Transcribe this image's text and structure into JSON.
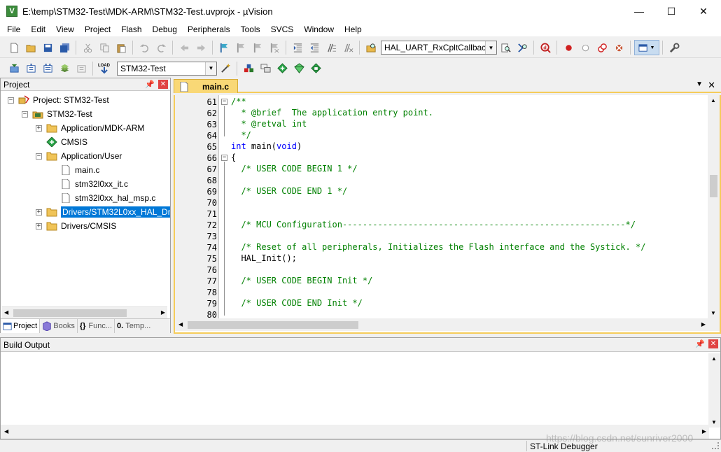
{
  "window": {
    "title": "E:\\temp\\STM32-Test\\MDK-ARM\\STM32-Test.uvprojx - µVision",
    "app_icon_label": "V",
    "minimize_glyph": "—",
    "maximize_glyph": "☐",
    "close_glyph": "✕"
  },
  "menu": [
    "File",
    "Edit",
    "View",
    "Project",
    "Flash",
    "Debug",
    "Peripherals",
    "Tools",
    "SVCS",
    "Window",
    "Help"
  ],
  "toolbar": {
    "function_combo_value": "HAL_UART_RxCpltCallbac",
    "target_combo_value": "STM32-Test",
    "load_label": "LOAD"
  },
  "project_panel": {
    "title": "Project",
    "pin_glyph": "📌",
    "close_glyph": "✕",
    "tree": [
      {
        "label": "Project: STM32-Test",
        "expander": "−",
        "icon": "project-icon"
      },
      {
        "label": "STM32-Test",
        "expander": "−",
        "icon": "target-icon"
      },
      {
        "label": "Application/MDK-ARM",
        "expander": "+",
        "icon": "folder-icon"
      },
      {
        "label": "CMSIS",
        "expander": "",
        "icon": "green-diamond-icon"
      },
      {
        "label": "Application/User",
        "expander": "−",
        "icon": "folder-icon"
      },
      {
        "label": "main.c",
        "expander": "",
        "icon": "file-icon"
      },
      {
        "label": "stm32l0xx_it.c",
        "expander": "",
        "icon": "file-icon"
      },
      {
        "label": "stm32l0xx_hal_msp.c",
        "expander": "",
        "icon": "file-icon"
      },
      {
        "label": "Drivers/STM32L0xx_HAL_Driv",
        "expander": "+",
        "icon": "folder-icon"
      },
      {
        "label": "Drivers/CMSIS",
        "expander": "+",
        "icon": "folder-icon"
      }
    ],
    "tabs": [
      {
        "label": "Project",
        "icon": "project-tab-icon"
      },
      {
        "label": "Books",
        "icon": "books-icon"
      },
      {
        "label": "Func...",
        "icon": "braces-icon"
      },
      {
        "label": "Temp...",
        "icon": "template-icon"
      }
    ],
    "tab_glyphs": {
      "braces": "{}",
      "template": "0."
    }
  },
  "editor": {
    "tab_label": "main.c",
    "tab_menu_glyph": "▼",
    "tab_close_glyph": "✕",
    "fold_minus": "−",
    "lines": [
      {
        "n": "61",
        "segs": [
          {
            "c": "cm",
            "t": "/**"
          }
        ]
      },
      {
        "n": "62",
        "segs": [
          {
            "c": "cm",
            "t": "  * @brief  The application entry point."
          }
        ]
      },
      {
        "n": "63",
        "segs": [
          {
            "c": "cm",
            "t": "  * @retval int"
          }
        ]
      },
      {
        "n": "64",
        "segs": [
          {
            "c": "cm",
            "t": "  */"
          }
        ]
      },
      {
        "n": "65",
        "segs": [
          {
            "c": "kw",
            "t": "int"
          },
          {
            "c": "tx",
            "t": " main("
          },
          {
            "c": "kw",
            "t": "void"
          },
          {
            "c": "tx",
            "t": ")"
          }
        ]
      },
      {
        "n": "66",
        "segs": [
          {
            "c": "tx",
            "t": "{"
          }
        ]
      },
      {
        "n": "67",
        "segs": [
          {
            "c": "cm",
            "t": "  /* USER CODE BEGIN 1 */"
          }
        ]
      },
      {
        "n": "68",
        "segs": []
      },
      {
        "n": "69",
        "segs": [
          {
            "c": "cm",
            "t": "  /* USER CODE END 1 */"
          }
        ]
      },
      {
        "n": "70",
        "segs": []
      },
      {
        "n": "71",
        "segs": []
      },
      {
        "n": "72",
        "segs": [
          {
            "c": "cm",
            "t": "  /* MCU Configuration--------------------------------------------------------*/"
          }
        ]
      },
      {
        "n": "73",
        "segs": []
      },
      {
        "n": "74",
        "segs": [
          {
            "c": "cm",
            "t": "  /* Reset of all peripherals, Initializes the Flash interface and the Systick. */"
          }
        ]
      },
      {
        "n": "75",
        "segs": [
          {
            "c": "tx",
            "t": "  HAL_Init();"
          }
        ]
      },
      {
        "n": "76",
        "segs": []
      },
      {
        "n": "77",
        "segs": [
          {
            "c": "cm",
            "t": "  /* USER CODE BEGIN Init */"
          }
        ]
      },
      {
        "n": "78",
        "segs": []
      },
      {
        "n": "79",
        "segs": [
          {
            "c": "cm",
            "t": "  /* USER CODE END Init */"
          }
        ]
      },
      {
        "n": "80",
        "segs": []
      }
    ]
  },
  "scroll_glyphs": {
    "up": "▲",
    "down": "▼",
    "left": "◀",
    "right": "▶"
  },
  "build_output": {
    "title": "Build Output",
    "pin_glyph": "📌",
    "close_glyph": "✕"
  },
  "status": {
    "debugger": "ST-Link Debugger",
    "watermark": "https://blog.csdn.net/sunriver2000"
  },
  "colors": {
    "selection": "#0078d7",
    "tab_active": "#f9d876",
    "comment": "#008000",
    "keyword": "#0000ff"
  }
}
